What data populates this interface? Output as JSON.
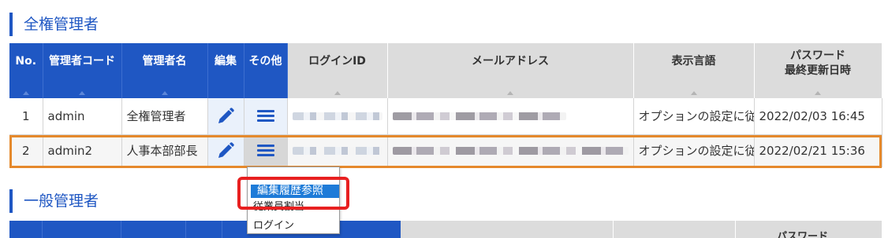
{
  "sections": {
    "full_admin_title": "全権管理者",
    "general_admin_title": "一般管理者"
  },
  "colors": {
    "header_blue": "#1f57c3",
    "header_gray": "#dcdcdc",
    "row_highlight": "#e5892c",
    "callout_red": "#e82020",
    "menu_selected": "#1e7bd8"
  },
  "table": {
    "headers": {
      "no": "No.",
      "code": "管理者コード",
      "name": "管理者名",
      "edit": "編集",
      "other": "その他",
      "login_id": "ログインID",
      "email": "メールアドレス",
      "language": "表示言語",
      "password_line1": "パスワード",
      "password_line2": "最終更新日時"
    },
    "rows": [
      {
        "no": "1",
        "code": "admin",
        "name": "全権管理者",
        "edit_icon": "pencil-icon",
        "other_icon": "hamburger-menu-icon",
        "language": "オプションの設定に従う",
        "password_updated": "2022/02/03 16:45"
      },
      {
        "no": "2",
        "code": "admin2",
        "name": "人事本部部長",
        "edit_icon": "pencil-icon",
        "other_icon": "hamburger-menu-icon",
        "language": "オプションの設定に従う",
        "password_updated": "2022/02/21 15:36"
      }
    ]
  },
  "other_menu": {
    "items": [
      "編集履歴参照",
      "従業員割当",
      "ログイン"
    ]
  },
  "general_table": {
    "password_header": "パスワード"
  }
}
